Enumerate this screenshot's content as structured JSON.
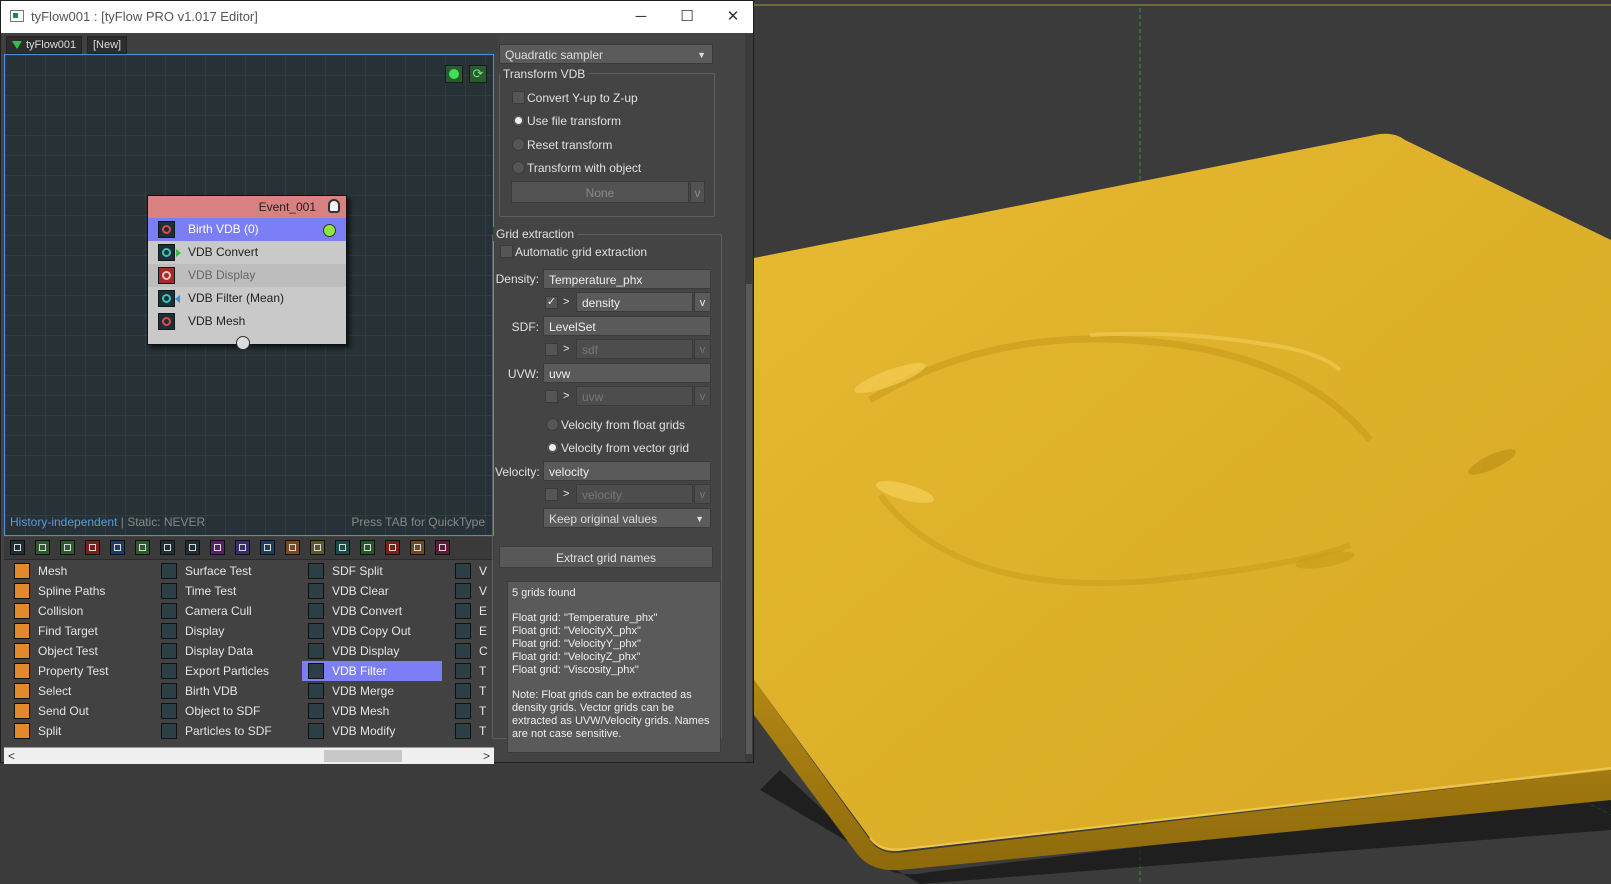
{
  "window": {
    "title": "tyFlow001 : [tyFlow PRO v1.017 Editor]",
    "controls": {
      "minimize": "─",
      "maximize": "☐",
      "close": "✕"
    }
  },
  "tabs": [
    {
      "label": "tyFlow001"
    },
    {
      "label": "[New]"
    }
  ],
  "graph": {
    "event": {
      "name": "Event_001",
      "operators": [
        {
          "label": "Birth VDB (0)",
          "state": "selected"
        },
        {
          "label": "VDB Convert",
          "state": "normal"
        },
        {
          "label": "VDB Display",
          "state": "disabled"
        },
        {
          "label": "VDB Filter (Mean)",
          "state": "normal"
        },
        {
          "label": "VDB Mesh",
          "state": "normal"
        }
      ]
    },
    "footer": {
      "history": "History-independent",
      "static": " | Static: NEVER",
      "hint": "Press TAB for QuickType"
    }
  },
  "palette": {
    "columns": [
      [
        "Mesh",
        "Spline Paths",
        "Collision",
        "Find Target",
        "Object Test",
        "Property Test",
        "Select",
        "Send Out",
        "Split"
      ],
      [
        "Surface Test",
        "Time Test",
        "Camera Cull",
        "Display",
        "Display Data",
        "Export Particles",
        "Birth VDB",
        "Object to SDF",
        "Particles to SDF"
      ],
      [
        "SDF Split",
        "VDB Clear",
        "VDB Convert",
        "VDB Copy Out",
        "VDB Display",
        "VDB Filter",
        "VDB Merge",
        "VDB Mesh",
        "VDB Modify"
      ],
      [
        "V",
        "V",
        "E",
        "E",
        "C",
        "T",
        "T",
        "T",
        "T"
      ]
    ],
    "highlighted": "VDB Filter"
  },
  "panel": {
    "sampler": "Quadratic sampler",
    "transform_vdb": {
      "title": "Transform VDB",
      "convert_y_up": {
        "label": "Convert Y-up to Z-up",
        "checked": false
      },
      "options": [
        {
          "label": "Use file transform",
          "selected": true
        },
        {
          "label": "Reset transform",
          "selected": false
        },
        {
          "label": "Transform with object",
          "selected": false
        }
      ],
      "object_button": "None",
      "object_v": "v"
    },
    "grid_extraction": {
      "title": "Grid extraction",
      "automatic": {
        "label": "Automatic grid extraction",
        "checked": false
      },
      "density": {
        "label": "Density:",
        "value": "Temperature_phx",
        "sub_value": "density",
        "sub_checked": true
      },
      "sdf": {
        "label": "SDF:",
        "value": "LevelSet",
        "sub_value": "sdf",
        "sub_checked": false
      },
      "uvw": {
        "label": "UVW:",
        "value": "uvw",
        "sub_value": "uvw",
        "sub_checked": false
      },
      "velocity_source": [
        {
          "label": "Velocity from float grids",
          "selected": false
        },
        {
          "label": "Velocity from vector grid",
          "selected": true
        }
      ],
      "velocity": {
        "label": "Velocity:",
        "value": "velocity",
        "sub_value": "velocity",
        "sub_checked": false
      },
      "keep_values": "Keep original values",
      "gt": ">",
      "v": "v",
      "extract_button": "Extract grid names",
      "info": {
        "found": "5 grids found",
        "grids": [
          "Float grid: \"Temperature_phx\"",
          "Float grid: \"VelocityX_phx\"",
          "Float grid: \"VelocityY_phx\"",
          "Float grid: \"VelocityZ_phx\"",
          "Float grid: \"Viscosity_phx\""
        ],
        "note": "Note: Float grids can be extracted as density grids. Vector grids can be extracted as UVW/Velocity grids. Names are not case sensitive."
      }
    }
  },
  "colors": {
    "selection": "#7b7ef5",
    "event_header": "#d98181",
    "mesh_yellow": "#e3b12c",
    "viewport_bg": "#3b3b3b",
    "history_link": "#5c9ad6"
  }
}
